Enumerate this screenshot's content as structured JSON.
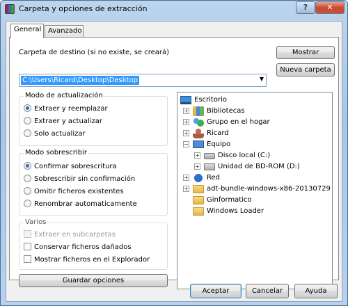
{
  "window": {
    "title": "Carpeta y opciones de extracción",
    "help_label": "?",
    "close_label": "✕"
  },
  "tabs": [
    {
      "label": "General",
      "active": true
    },
    {
      "label": "Avanzado",
      "active": false
    }
  ],
  "destination": {
    "label": "Carpeta de destino (si no existe, se creará)",
    "value": "C:\\Users\\Ricard\\Desktop\\Desktop",
    "show_button": "Mostrar",
    "new_folder_button": "Nueva carpeta"
  },
  "update_mode": {
    "title": "Modo de actualización",
    "options": [
      {
        "label": "Extraer y reemplazar",
        "selected": true
      },
      {
        "label": "Extraer y actualizar",
        "selected": false
      },
      {
        "label": "Solo actualizar",
        "selected": false
      }
    ]
  },
  "overwrite_mode": {
    "title": "Modo sobrescribir",
    "options": [
      {
        "label": "Confirmar sobrescritura",
        "selected": true
      },
      {
        "label": "Sobrescribir sin confirmación",
        "selected": false
      },
      {
        "label": "Omitir ficheros existentes",
        "selected": false
      },
      {
        "label": "Renombrar automaticamente",
        "selected": false
      }
    ]
  },
  "misc": {
    "title": "Varios",
    "options": [
      {
        "label": "Extraer en subcarpetas",
        "checked": false,
        "enabled": false
      },
      {
        "label": "Conservar ficheros dañados",
        "checked": false,
        "enabled": true
      },
      {
        "label": "Mostrar ficheros en el Explorador",
        "checked": false,
        "enabled": true
      }
    ]
  },
  "save_options_button": "Guardar opciones",
  "tree": {
    "items": [
      {
        "label": "Escritorio",
        "icon": "desktop-icon"
      },
      {
        "label": "Bibliotecas",
        "icon": "library-icon"
      },
      {
        "label": "Grupo en el hogar",
        "icon": "homegroup-icon"
      },
      {
        "label": "Ricard",
        "icon": "user-icon"
      },
      {
        "label": "Equipo",
        "icon": "computer-icon"
      },
      {
        "label": "Disco local (C:)",
        "icon": "drive-icon"
      },
      {
        "label": "Unidad de BD-ROM (D:)",
        "icon": "dvd-drive-icon"
      },
      {
        "label": "Red",
        "icon": "network-icon"
      },
      {
        "label": "adt-bundle-windows-x86-20130729",
        "icon": "folder-icon"
      },
      {
        "label": "Ginformatico",
        "icon": "folder-icon"
      },
      {
        "label": "Windows Loader",
        "icon": "folder-icon"
      }
    ]
  },
  "footer": {
    "accept": "Aceptar",
    "cancel": "Cancelar",
    "help": "Ayuda"
  }
}
